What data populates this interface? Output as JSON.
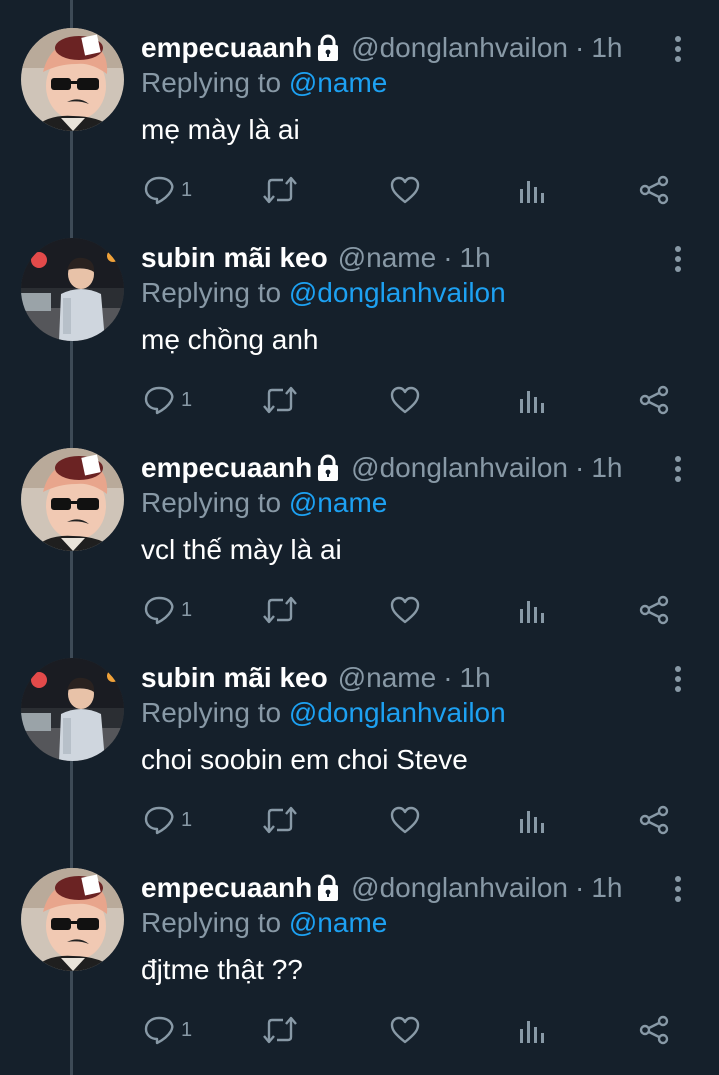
{
  "colors": {
    "background": "#15202b",
    "secondary_text": "#8899a6",
    "mention": "#1da1f2",
    "thread_line": "#3d4a56"
  },
  "tweets": [
    {
      "name": "empecuaanh",
      "locked": true,
      "handle": "@donglanhvailon",
      "separator": "·",
      "time": "1h",
      "replying_prefix": "Replying to",
      "replying_to": "@name",
      "text": "mẹ mày là ai",
      "reply_count": "1"
    },
    {
      "name": "subin mãi keo",
      "locked": false,
      "handle": "@name",
      "separator": "·",
      "time": "1h",
      "replying_prefix": "Replying to",
      "replying_to": "@donglanhvailon",
      "text": "mẹ chồng anh",
      "reply_count": "1"
    },
    {
      "name": "empecuaanh",
      "locked": true,
      "handle": "@donglanhvailon",
      "separator": "·",
      "time": "1h",
      "replying_prefix": "Replying to",
      "replying_to": "@name",
      "text": "vcl thế mày là ai",
      "reply_count": "1"
    },
    {
      "name": "subin mãi keo",
      "locked": false,
      "handle": "@name",
      "separator": "·",
      "time": "1h",
      "replying_prefix": "Replying to",
      "replying_to": "@donglanhvailon",
      "text": "choi soobin em choi Steve",
      "reply_count": "1"
    },
    {
      "name": "empecuaanh",
      "locked": true,
      "handle": "@donglanhvailon",
      "separator": "·",
      "time": "1h",
      "replying_prefix": "Replying to",
      "replying_to": "@name",
      "text": "đjtme thật ??",
      "reply_count": "1"
    }
  ],
  "icons": {
    "reply": "reply-icon",
    "retweet": "retweet-icon",
    "like": "heart-icon",
    "analytics": "analytics-icon",
    "share": "share-icon",
    "more": "more-vertical-icon",
    "lock": "lock-icon"
  }
}
